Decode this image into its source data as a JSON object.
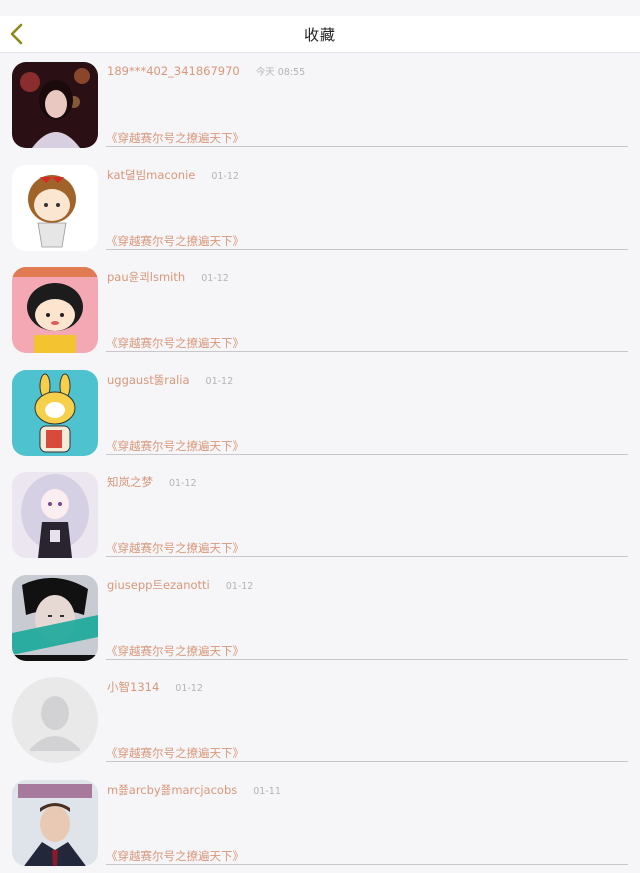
{
  "nav": {
    "title": "收藏",
    "accent_color": "#8a8a1e"
  },
  "colors": {
    "name_text": "#d8987a",
    "time_text": "#b5b3b8",
    "background": "#f6f5f8"
  },
  "favorites": [
    {
      "user": "189***402_341867970",
      "time": "今天 08:55",
      "book": "《穿越赛尔号之撩遍天下》",
      "avatar": "photo-girl-red-night"
    },
    {
      "user": "kat뎔빔maconie",
      "time": "01-12",
      "book": "《穿越赛尔号之撩遍天下》",
      "avatar": "cartoon-girl-red-bow"
    },
    {
      "user": "pau윤쾨lsmith",
      "time": "01-12",
      "book": "《穿越赛尔号之撩遍天下》",
      "avatar": "cartoon-chibi-maruko"
    },
    {
      "user": "uggaust뚫ralia",
      "time": "01-12",
      "book": "《穿越赛尔号之撩遍天下》",
      "avatar": "cartoon-yellow-bunny"
    },
    {
      "user": "知岚之梦",
      "time": "01-12",
      "book": "《穿越赛尔号之撩遍天下》",
      "avatar": "anime-white-hair-girl"
    },
    {
      "user": "giusepp트ezanotti",
      "time": "01-12",
      "book": "《穿越赛尔号之撩遍天下》",
      "avatar": "photo-boy-dark-hair"
    },
    {
      "user": "小智1314",
      "time": "01-12",
      "book": "《穿越赛尔号之撩遍天下》",
      "avatar": "default-silhouette"
    },
    {
      "user": "m쬻arcby쬻marcjacobs",
      "time": "01-11",
      "book": "《穿越赛尔号之撩遍天下》",
      "avatar": "photo-man-suit"
    }
  ]
}
